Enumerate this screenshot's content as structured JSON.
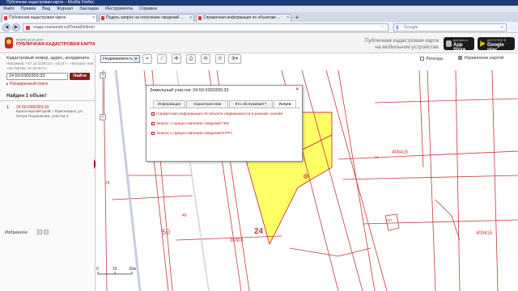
{
  "browser": {
    "window_title": "Публичная кадастровая карта – Mozilla Firefox",
    "menu": [
      "Файл",
      "Правка",
      "Вид",
      "Журнал",
      "Закладки",
      "Инструменты",
      "Справка"
    ],
    "tabs": [
      {
        "label": "Публичная кадастровая карта",
        "active": true
      },
      {
        "label": "Подать запрос на получение сведений ...",
        "active": false
      },
      {
        "label": "Справочная информация по объектам ...",
        "active": false
      }
    ],
    "new_tab": "+",
    "url": "maps.rosreestr.ru/PortalOnline/",
    "search_placeholder": "Google",
    "search_engine_glyph": "g"
  },
  "site": {
    "portal_label": "ПОРТАЛ УСЛУГ",
    "name": "ПУБЛИЧНАЯ КАДАСТРОВАЯ КАРТА",
    "mobile_line1": "Публичная кадастровая карта",
    "mobile_line2": "на мобильном устройстве",
    "appstore_small": "Доступно в",
    "appstore_big": "App Store",
    "gplay_small": "ДОСТУПНО В",
    "gplay_big": "Google play",
    "brand_color": "#b71c1c"
  },
  "left_panel": {
    "search_label": "Кадастровый номер, адрес, координата",
    "search_hint": "Например: «47:15:3100:12», «61.6°», «Москва» или «55.755768, 37.617671»",
    "search_value": "24:50:0300303:33",
    "find_button": "Найти",
    "advanced_search": "▸ Расширенный поиск",
    "found": "Найден 1 объект",
    "result_num": "1.",
    "result_code": "24:50:0300303:33",
    "result_address": "Красноярский край, г Красноярск, ул. Петра Подзолкова, участок 2",
    "favorites": "Избранное"
  },
  "map": {
    "layer_select": "Недвижимость",
    "legend_label": "Легенда",
    "manage_label": "Управление картой",
    "labels": {
      "l50": "50",
      "l24": "24",
      "l30303": "30303",
      "l400415a": "400415",
      "l400415b": "400415",
      "l49": "49",
      "l78": "78",
      "l237": "237",
      "l26": "26"
    },
    "scale": {
      "s0": "0",
      "s15": "15",
      "s30m": "30м"
    },
    "parcel_fill": "#ffff66",
    "line_color": "#c43a3a"
  },
  "popup": {
    "title": "Земельный участок: 24:50:0300303:33",
    "close": "×",
    "tabs": [
      "Информация",
      "Характеристики",
      "Кто обслуживает?",
      "Услуги"
    ],
    "active_tab": "Услуги",
    "links": [
      "Справочная информация об объекте недвижимости в режиме онлайн",
      "Запрос о предоставлении сведений ГКН",
      "Запрос о предоставлении сведений ЕГРП"
    ]
  }
}
